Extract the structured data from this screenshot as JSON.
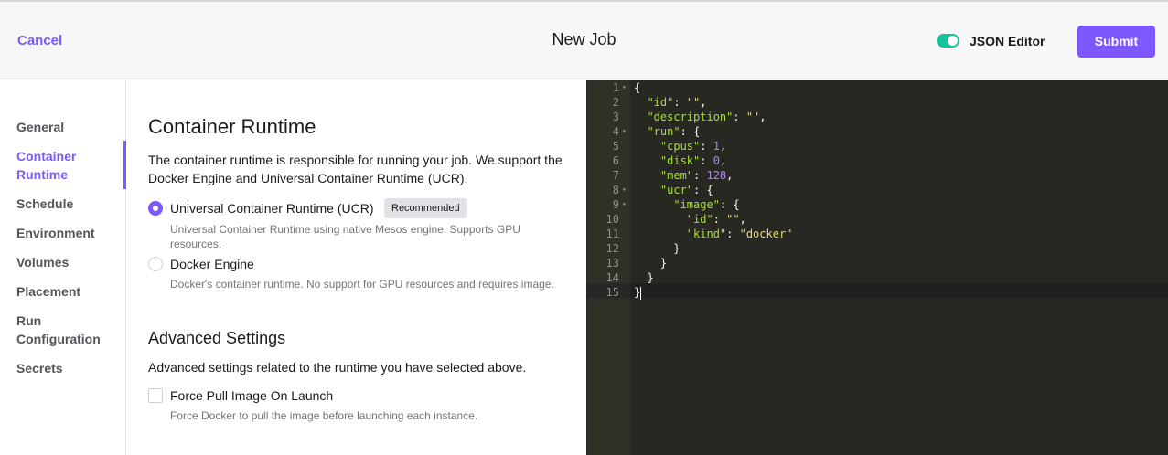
{
  "header": {
    "cancel": "Cancel",
    "title": "New Job",
    "json_editor_label": "JSON Editor",
    "json_editor_on": true,
    "submit": "Submit"
  },
  "sidebar": {
    "items": [
      {
        "label": "General"
      },
      {
        "label": "Container\nRuntime",
        "active": true
      },
      {
        "label": "Schedule"
      },
      {
        "label": "Environment"
      },
      {
        "label": "Volumes"
      },
      {
        "label": "Placement"
      },
      {
        "label": "Run\nConfiguration"
      },
      {
        "label": "Secrets"
      }
    ]
  },
  "main": {
    "heading": "Container Runtime",
    "description": "The container runtime is responsible for running your job. We support the Docker Engine and Universal Container Runtime (UCR).",
    "options": [
      {
        "label": "Universal Container Runtime (UCR)",
        "badge": "Recommended",
        "selected": true,
        "help": "Universal Container Runtime using native Mesos engine. Supports GPU resources."
      },
      {
        "label": "Docker Engine",
        "selected": false,
        "help": "Docker's container runtime. No support for GPU resources and requires image."
      }
    ],
    "advanced": {
      "heading": "Advanced Settings",
      "description": "Advanced settings related to the runtime you have selected above.",
      "force_pull_label": "Force Pull Image On Launch",
      "force_pull_checked": false,
      "force_pull_help": "Force Docker to pull the image before launching each instance."
    }
  },
  "editor": {
    "lines": [
      "{",
      "  \"id\": \"\",",
      "  \"description\": \"\",",
      "  \"run\": {",
      "    \"cpus\": 1,",
      "    \"disk\": 0,",
      "    \"mem\": 128,",
      "    \"ucr\": {",
      "      \"image\": {",
      "        \"id\": \"\",",
      "        \"kind\": \"docker\"",
      "      }",
      "    }",
      "  }",
      "}"
    ],
    "foldable_lines": [
      1,
      4,
      8,
      9
    ]
  },
  "colors": {
    "accent": "#7d58ff",
    "toggle_on": "#16c39b",
    "editor_bg": "#272822",
    "json_key": "#a6e22e",
    "json_string": "#e6db74",
    "json_number": "#ae81ff"
  }
}
